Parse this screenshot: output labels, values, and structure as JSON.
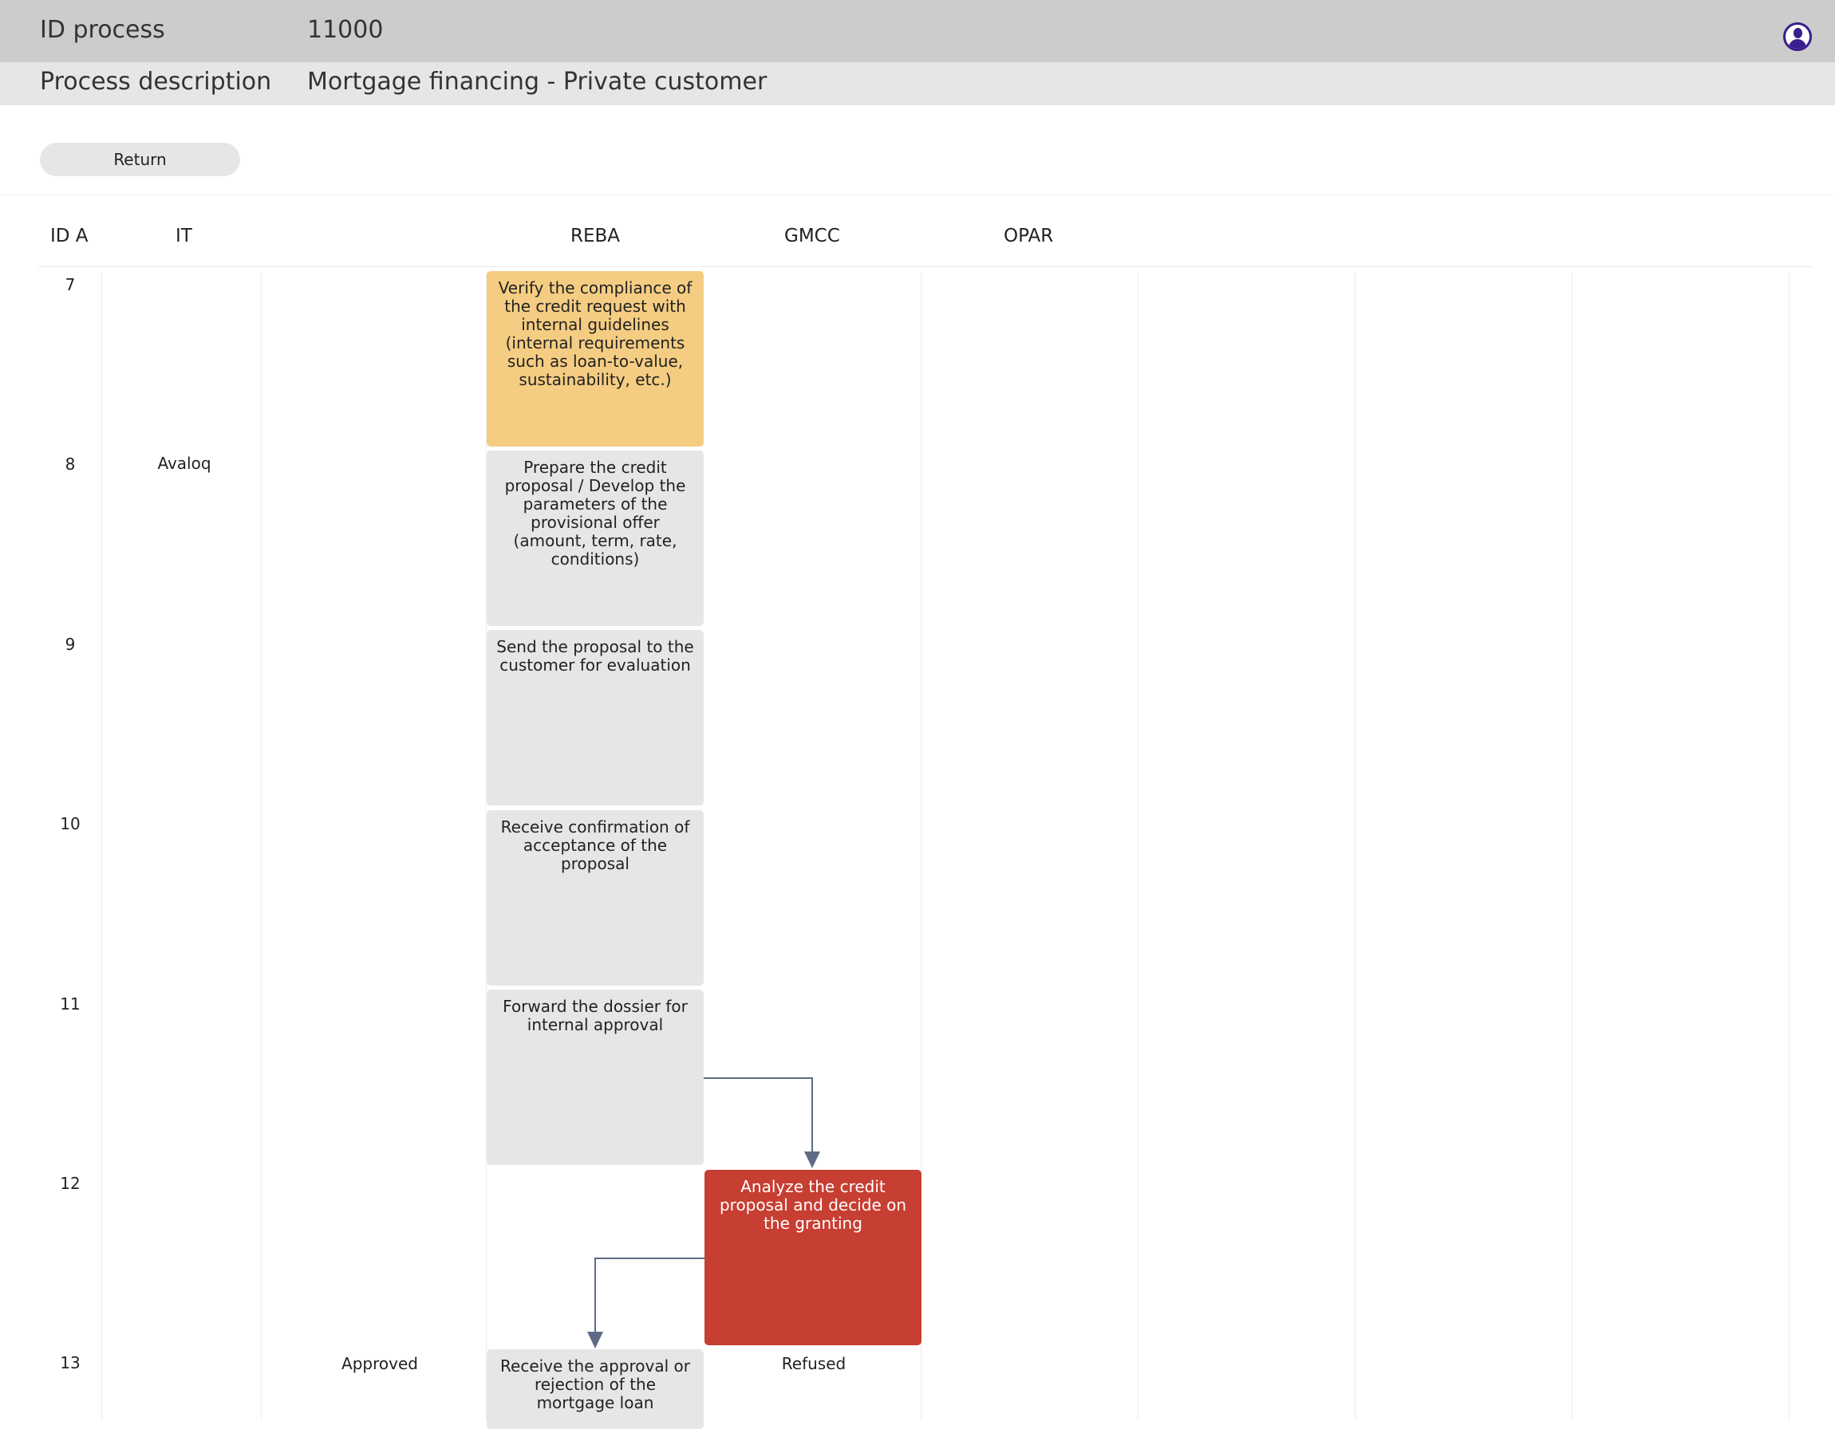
{
  "header": {
    "id_label": "ID process",
    "id_value": "11000",
    "desc_label": "Process description",
    "desc_value": "Mortgage financing - Private customer"
  },
  "toolbar": {
    "return_label": "Return"
  },
  "columns": {
    "id": "ID A",
    "it": "IT",
    "reba": "REBA",
    "gmcc": "GMCC",
    "opar": "OPAR"
  },
  "rows": [
    {
      "id": "7",
      "it": "",
      "reba": "Verify the compliance of the credit request with internal guidelines (internal requirements such as loan-to-value, sustainability, etc.)"
    },
    {
      "id": "8",
      "it": "Avaloq",
      "reba": "Prepare the credit proposal / Develop the parameters of the provisional offer (amount, term, rate, conditions)"
    },
    {
      "id": "9",
      "it": "",
      "reba": "Send the proposal to the customer for evaluation"
    },
    {
      "id": "10",
      "it": "",
      "reba": "Receive confirmation of acceptance of the proposal"
    },
    {
      "id": "11",
      "it": "",
      "reba": "Forward the dossier for internal approval"
    },
    {
      "id": "12",
      "it": "",
      "gmcc": "Analyze the credit proposal and decide on the granting"
    },
    {
      "id": "13",
      "it": "",
      "pre": "Approved",
      "reba": "Receive the approval or rejection of the mortgage loan",
      "gmcc": "Refused"
    }
  ],
  "colors": {
    "topbar": "#cccccc",
    "descbar": "#e6e6e6",
    "task_gray": "#e6e6e6",
    "task_highlight": "#f5cd82",
    "task_decision": "#c73e32",
    "connector": "#5f6b84",
    "user_icon": "#3a1d8c"
  },
  "icons": {
    "user": "user-icon"
  }
}
